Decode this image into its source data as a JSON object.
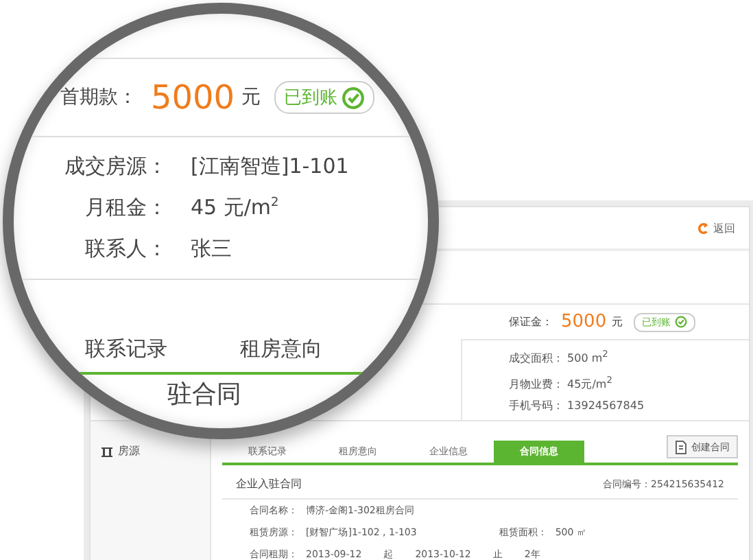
{
  "page": {
    "back": "返回",
    "deposit": {
      "label": "保证金：",
      "amount": "5000",
      "unit": "元",
      "status": "已到账",
      "paid": true
    },
    "details": [
      {
        "label": "成交面积：",
        "value": "500 m$^{2}$"
      },
      {
        "label": "月物业费：",
        "value": "45元/m$^{2}$"
      },
      {
        "label": "手机号码：",
        "value": "13924567845"
      }
    ],
    "sidebar": [
      {
        "label": "房源"
      }
    ],
    "tabs": [
      {
        "label": "联系记录",
        "selected": false
      },
      {
        "label": "租房意向",
        "selected": false
      },
      {
        "label": "企业信息",
        "selected": false
      },
      {
        "label": "合同信息",
        "selected": true
      }
    ],
    "create_button": "创建合同",
    "contract": {
      "title": "企业入驻合同",
      "number_label": "合同编号：",
      "number": "254215635412",
      "rows": [
        {
          "items": [
            {
              "label": "合同名称：",
              "values": [
                "博济-金阁1-302租房合同"
              ]
            }
          ]
        },
        {
          "items": [
            {
              "label": "租赁房源：",
              "values": [
                "[财智广场]1-102 , 1-103"
              ]
            },
            {
              "label": "租赁面积：",
              "values": [
                "500 ㎡"
              ]
            }
          ]
        },
        {
          "items": [
            {
              "label": "合同租期：",
              "values": [
                "2013-09-12",
                "起",
                "2013-10-12",
                "止",
                "2年"
              ]
            }
          ]
        }
      ]
    }
  },
  "magnifier": {
    "down_payment": {
      "label": "首期款：",
      "amount": "5000",
      "unit": "元",
      "status": "已到账",
      "paid": true
    },
    "details": [
      {
        "label": "成交房源：",
        "value": "[江南智造]1-101"
      },
      {
        "label": "月租金：",
        "value": "45 元/m$^{2}$"
      },
      {
        "label": "联系人：",
        "value": "张三"
      }
    ],
    "tabs": [
      {
        "label": "联系记录"
      },
      {
        "label": "租房意向"
      }
    ],
    "heading": "驻合同"
  }
}
